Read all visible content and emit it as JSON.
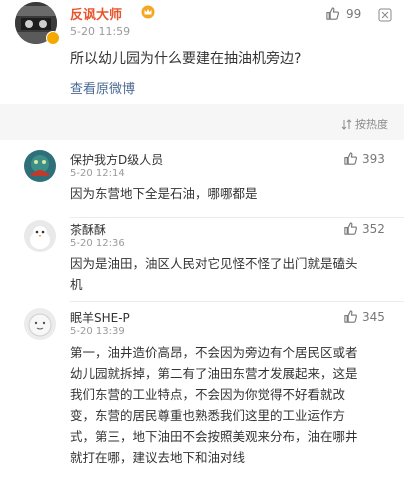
{
  "post": {
    "author": "反讽大师",
    "time": "5-20 11:59",
    "like_count": "99",
    "text": "所以幼儿园为什么要建在抽油机旁边?",
    "view_original": "查看原微博"
  },
  "sort": {
    "label": "按热度"
  },
  "comments": [
    {
      "author": "保护我方D级人员",
      "time": "5-20 12:14",
      "likes": "393",
      "lines": [
        "因为东营地下全是石油，哪哪都是"
      ]
    },
    {
      "author": "茶酥酥",
      "time": "5-20 12:36",
      "likes": "352",
      "lines": [
        "因为是油田，油区人民对它见怪不怪了出门就是磕头",
        "机"
      ]
    },
    {
      "author": "眠羊SHE-P",
      "time": "5-20 13:39",
      "likes": "345",
      "lines": [
        "第一，油井造价高昂，不会因为旁边有个居民区或者",
        "幼儿园就拆掉，第二有了油田东营才发展起来，这是",
        "我们东营的工业特点，不会因为你觉得不好看就改",
        "变，东营的居民尊重也熟悉我们这里的工业运作方",
        "式，第三，地下油田不会按照美观来分布，油在哪井",
        "就打在哪，建议去地下和油对线"
      ]
    }
  ],
  "colors": {
    "author_accent": "#e8552d",
    "link": "#4a6a92",
    "muted": "#9a9a9a"
  },
  "icons": [
    "crown-icon",
    "thumbs-up-icon",
    "more-icon",
    "sort-icon",
    "verified-badge-icon"
  ]
}
